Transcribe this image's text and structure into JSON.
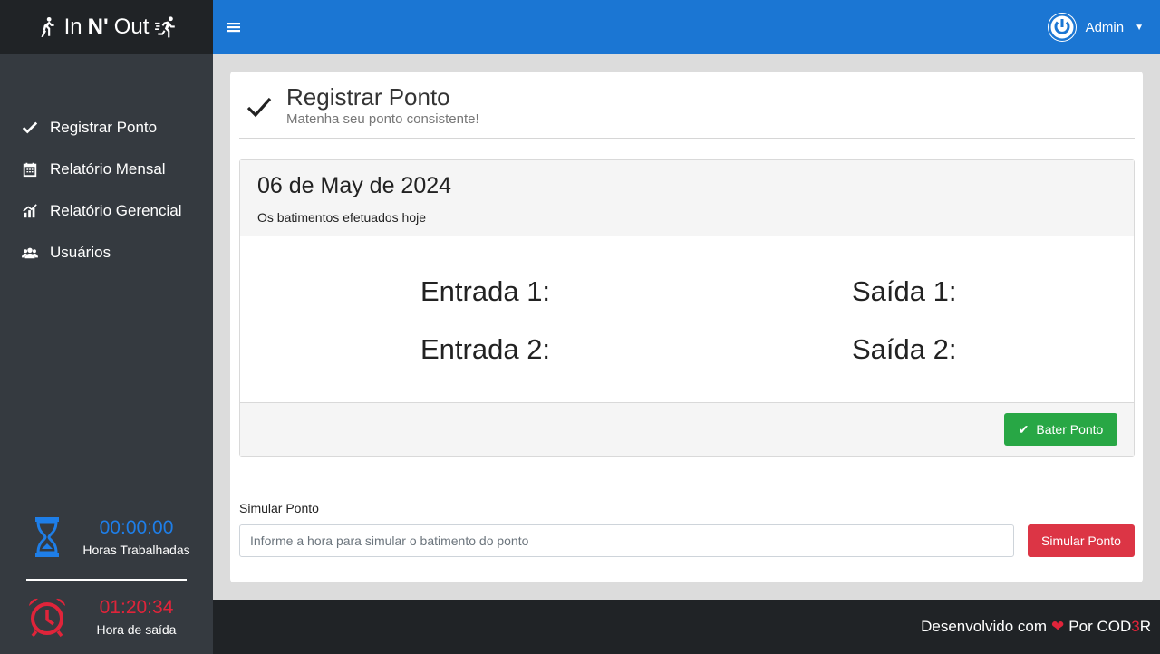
{
  "brand": {
    "prefix": "In",
    "bold": "N'",
    "suffix": "Out"
  },
  "sidebar": {
    "items": [
      {
        "label": "Registrar Ponto",
        "icon": "check-icon"
      },
      {
        "label": "Relatório Mensal",
        "icon": "calendar-icon"
      },
      {
        "label": "Relatório Gerencial",
        "icon": "chart-icon"
      },
      {
        "label": "Usuários",
        "icon": "users-icon"
      }
    ],
    "worked": {
      "value": "00:00:00",
      "label": "Horas Trabalhadas",
      "color": "#1e7ee8"
    },
    "exit": {
      "value": "01:20:34",
      "label": "Hora de saída",
      "color": "#e0243a"
    }
  },
  "header": {
    "menu_icon": "hamburger-icon",
    "user": "Admin"
  },
  "page": {
    "title": "Registrar Ponto",
    "subtitle": "Matenha seu ponto consistente!"
  },
  "panel": {
    "date": "06 de May de 2024",
    "description": "Os batimentos efetuados hoje",
    "entrada1": "Entrada 1:",
    "saida1": "Saída 1:",
    "entrada2": "Entrada 2:",
    "saida2": "Saída 2:",
    "button": "Bater Ponto"
  },
  "simulate": {
    "label": "Simular Ponto",
    "placeholder": "Informe a hora para simular o batimento do ponto",
    "button": "Simular Ponto"
  },
  "footer": {
    "text": "Desenvolvido com",
    "by": "Por COD",
    "accent": "3",
    "end": "R"
  },
  "colors": {
    "primary": "#1b76d3",
    "success": "#28a745",
    "danger": "#dc3545"
  }
}
